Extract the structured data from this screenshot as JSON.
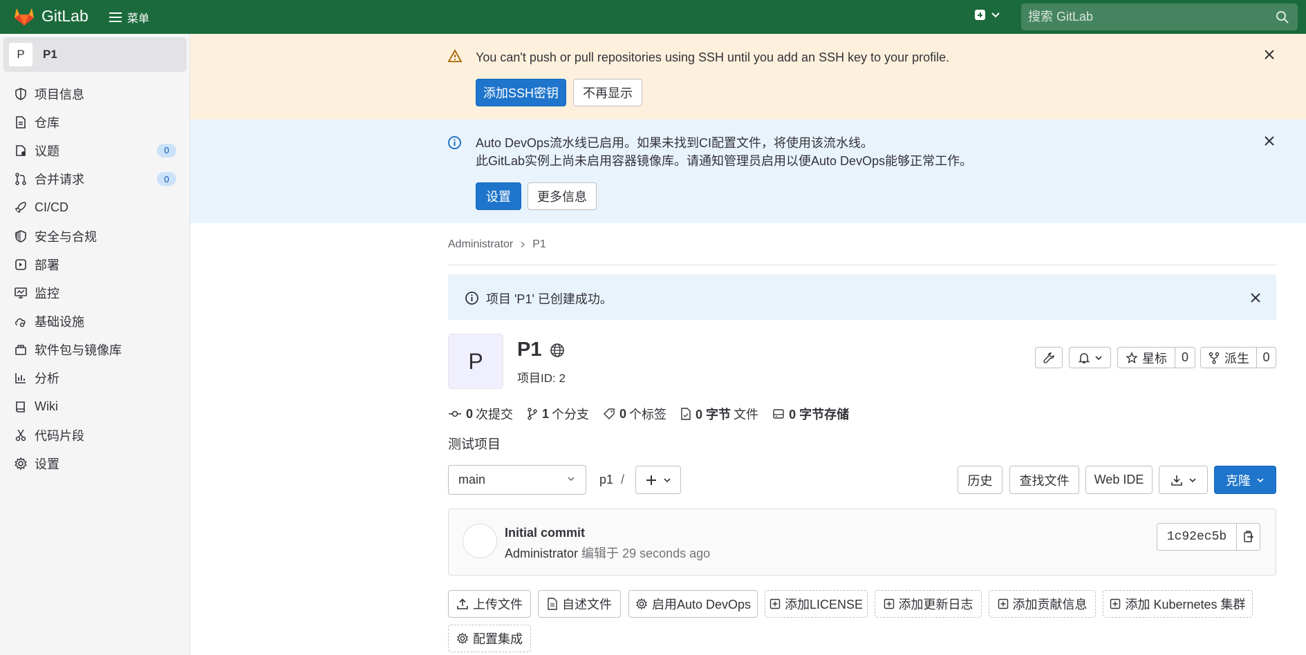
{
  "topbar": {
    "app_name": "GitLab",
    "menu_label": "菜单",
    "search_placeholder": "搜索 GitLab",
    "accent": "#1b6a3b"
  },
  "sidebar": {
    "project_avatar": "P",
    "project_name": "P1",
    "items": [
      {
        "label": "项目信息",
        "icon": "info-shield-icon"
      },
      {
        "label": "仓库",
        "icon": "document-icon"
      },
      {
        "label": "议题",
        "icon": "issues-icon",
        "count": "0"
      },
      {
        "label": "合并请求",
        "icon": "merge-request-icon",
        "count": "0"
      },
      {
        "label": "CI/CD",
        "icon": "rocket-icon"
      },
      {
        "label": "安全与合规",
        "icon": "shield-icon"
      },
      {
        "label": "部署",
        "icon": "deploy-icon"
      },
      {
        "label": "监控",
        "icon": "monitor-icon"
      },
      {
        "label": "基础设施",
        "icon": "cloud-gear-icon"
      },
      {
        "label": "软件包与镜像库",
        "icon": "package-icon"
      },
      {
        "label": "分析",
        "icon": "chart-icon"
      },
      {
        "label": "Wiki",
        "icon": "book-icon"
      },
      {
        "label": "代码片段",
        "icon": "scissors-icon"
      },
      {
        "label": "设置",
        "icon": "gear-icon"
      }
    ]
  },
  "ssh_alert": {
    "message": "You can't push or pull repositories using SSH until you add an SSH key to your profile.",
    "add_button": "添加SSH密钥",
    "dismiss_button": "不再显示",
    "color": "#fdf1dd"
  },
  "devops_alert": {
    "line1": "Auto DevOps流水线已启用。如果未找到CI配置文件，将使用该流水线。",
    "line2": "此GitLab实例上尚未启用容器镜像库。请通知管理员启用以便Auto DevOps能够正常工作。",
    "settings_button": "设置",
    "more_button": "更多信息",
    "color": "#e9f3fc"
  },
  "breadcrumb": {
    "items": [
      "Administrator",
      "P1"
    ]
  },
  "success_alert": {
    "message": "项目 'P1' 已创建成功。"
  },
  "project": {
    "avatar": "P",
    "name": "P1",
    "id_label": "项目ID: 2",
    "star_label": "星标",
    "star_count": "0",
    "fork_label": "派生",
    "fork_count": "0",
    "description": "测试项目"
  },
  "stats": [
    {
      "icon": "commit-icon",
      "value": "0",
      "label": "次提交"
    },
    {
      "icon": "branch-icon",
      "value": "1",
      "label": "个分支"
    },
    {
      "icon": "tag-icon",
      "value": "0",
      "label": "个标签"
    },
    {
      "icon": "file-icon",
      "value": "0 字节",
      "label": "文件"
    },
    {
      "icon": "storage-icon",
      "value": "0 字节存储",
      "label": ""
    }
  ],
  "repo_toolbar": {
    "branch": "main",
    "path": "p1",
    "path_sep": "/",
    "history": "历史",
    "find_file": "查找文件",
    "web_ide": "Web IDE",
    "clone": "克隆"
  },
  "commit": {
    "title": "Initial commit",
    "author": "Administrator",
    "edited": "编辑于",
    "time": "29 seconds ago",
    "sha": "1c92ec5b"
  },
  "quick_actions": [
    {
      "label": "上传文件",
      "icon": "upload-icon",
      "dashed": false
    },
    {
      "label": "自述文件",
      "icon": "file-icon",
      "dashed": false
    },
    {
      "label": "启用Auto DevOps",
      "icon": "gear-icon",
      "dashed": false
    },
    {
      "label": "添加LICENSE",
      "icon": "plus-square-icon",
      "dashed": true
    },
    {
      "label": "添加更新日志",
      "icon": "plus-square-icon",
      "dashed": true
    },
    {
      "label": "添加贡献信息",
      "icon": "plus-square-icon",
      "dashed": true
    },
    {
      "label": "添加 Kubernetes 集群",
      "icon": "plus-square-icon",
      "dashed": true
    },
    {
      "label": "配置集成",
      "icon": "gear-icon",
      "dashed": true
    }
  ]
}
